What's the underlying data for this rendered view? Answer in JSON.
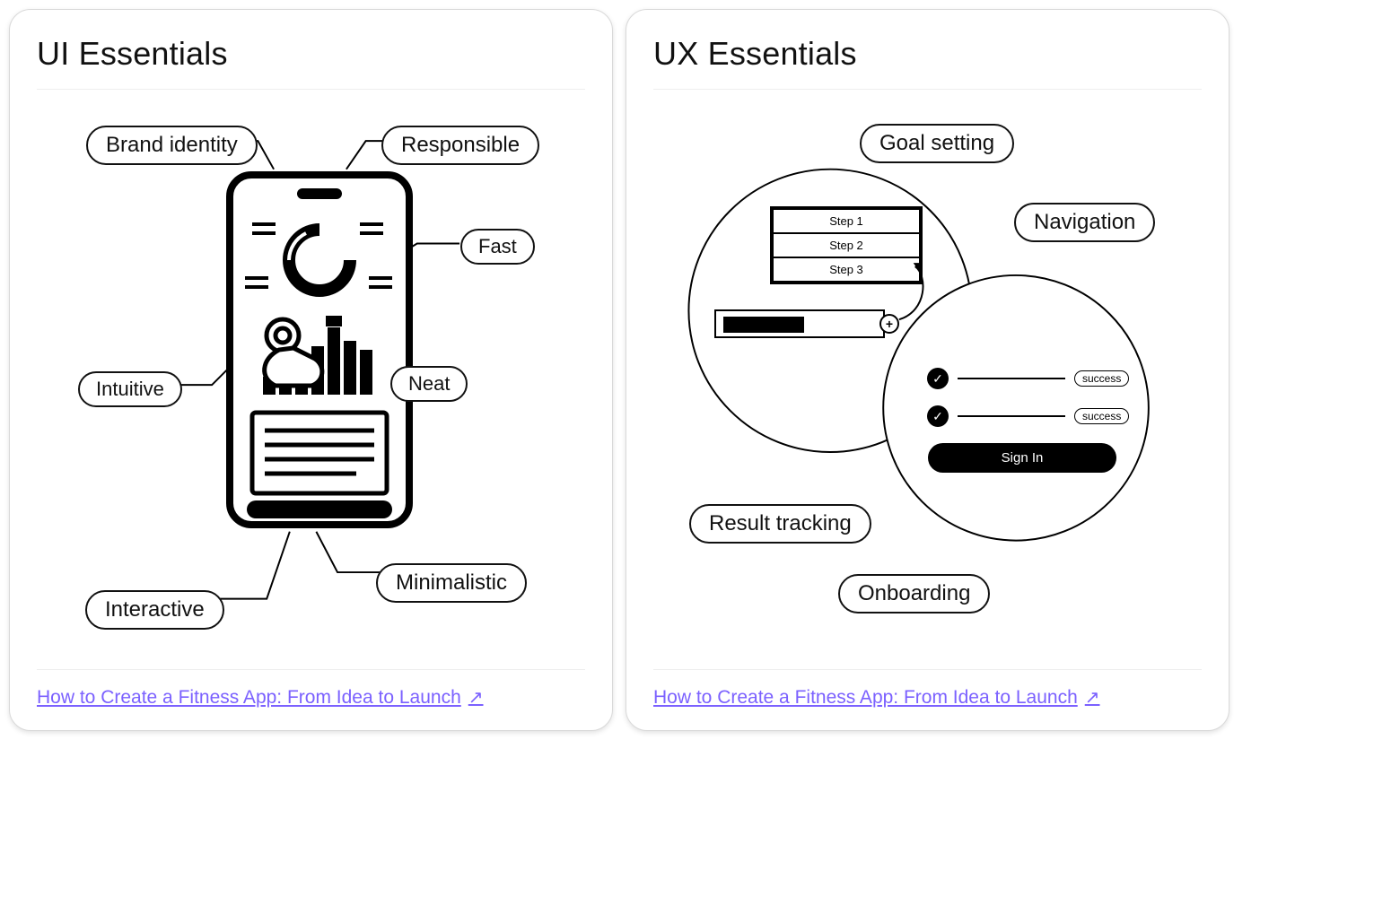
{
  "cards": {
    "ui": {
      "title": "UI Essentials",
      "labels": {
        "brand": "Brand identity",
        "responsible": "Responsible",
        "fast": "Fast",
        "intuitive": "Intuitive",
        "neat": "Neat",
        "minimalistic": "Minimalistic",
        "interactive": "Interactive"
      },
      "link": "How to Create a Fitness App: From Idea to Launch"
    },
    "ux": {
      "title": "UX Essentials",
      "labels": {
        "goal": "Goal setting",
        "navigation": "Navigation",
        "result": "Result tracking",
        "onboarding": "Onboarding"
      },
      "steps": {
        "s1": "Step 1",
        "s2": "Step 2",
        "s3": "Step 3"
      },
      "success1": "success",
      "success2": "success",
      "signin": "Sign In",
      "link": "How to Create a Fitness App: From Idea to Launch"
    }
  }
}
